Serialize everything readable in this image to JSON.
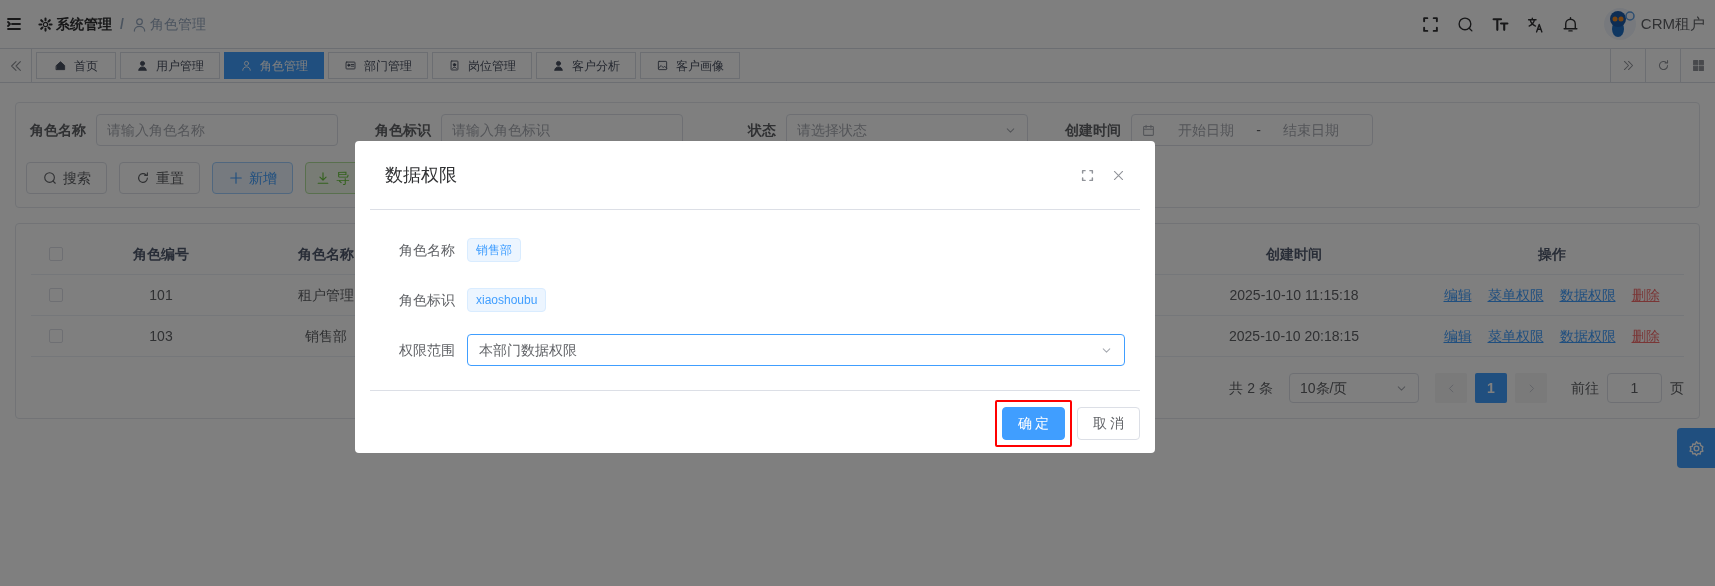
{
  "topbar": {
    "breadcrumb": [
      {
        "label": "系统管理",
        "current": false
      },
      {
        "label": "角色管理",
        "current": true
      }
    ],
    "separator": "/",
    "user": "CRM租户"
  },
  "tabs": [
    {
      "label": "首页",
      "selected": false
    },
    {
      "label": "用户管理",
      "selected": false
    },
    {
      "label": "角色管理",
      "selected": true
    },
    {
      "label": "部门管理",
      "selected": false
    },
    {
      "label": "岗位管理",
      "selected": false
    },
    {
      "label": "客户分析",
      "selected": false
    },
    {
      "label": "客户画像",
      "selected": false
    }
  ],
  "filters": [
    {
      "label": "角色名称",
      "kind": "input",
      "placeholder": "请输入角色名称"
    },
    {
      "label": "角色标识",
      "kind": "input",
      "placeholder": "请输入角色标识"
    },
    {
      "label": "状态",
      "kind": "select",
      "placeholder": "请选择状态"
    },
    {
      "label": "创建时间",
      "kind": "daterange",
      "start_placeholder": "开始日期",
      "separator": "-",
      "end_placeholder": "结束日期"
    }
  ],
  "toolbar": [
    {
      "label": "搜索",
      "kind": "default"
    },
    {
      "label": "重置",
      "kind": "default"
    },
    {
      "label": "新增",
      "kind": "primary"
    },
    {
      "label": "导",
      "kind": "success"
    }
  ],
  "table": {
    "select_all_checked": false,
    "columns": [
      "角色编号",
      "角色名称",
      "创建时间",
      "操作"
    ],
    "rows": [
      {
        "checked": false,
        "cells": [
          "101",
          "租户管理",
          "2025-10-10 11:15:18"
        ],
        "actions": [
          {
            "label": "编辑",
            "kind": "link"
          },
          {
            "label": "菜单权限",
            "kind": "link"
          },
          {
            "label": "数据权限",
            "kind": "link"
          },
          {
            "label": "删除",
            "kind": "danger"
          }
        ]
      },
      {
        "checked": false,
        "cells": [
          "103",
          "销售部",
          "2025-10-10 20:18:15"
        ],
        "actions": [
          {
            "label": "编辑",
            "kind": "link"
          },
          {
            "label": "菜单权限",
            "kind": "link"
          },
          {
            "label": "数据权限",
            "kind": "link"
          },
          {
            "label": "删除",
            "kind": "danger"
          }
        ]
      }
    ]
  },
  "pagination": {
    "total": "共 2 条",
    "page_size": "10条/页",
    "pages": [
      {
        "label": "1",
        "selected": true
      }
    ],
    "goto_label": "前往",
    "goto_value": "1",
    "goto_suffix": "页"
  },
  "dialog": {
    "title": "数据权限",
    "fields": [
      {
        "label": "角色名称",
        "kind": "tag",
        "value": "销售部"
      },
      {
        "label": "角色标识",
        "kind": "tag",
        "value": "xiaoshoubu"
      },
      {
        "label": "权限范围",
        "kind": "select",
        "value": "本部门数据权限"
      }
    ],
    "buttons": [
      {
        "label": "确 定",
        "kind": "primary",
        "highlighted": true
      },
      {
        "label": "取 消",
        "kind": "default",
        "highlighted": false
      }
    ]
  }
}
